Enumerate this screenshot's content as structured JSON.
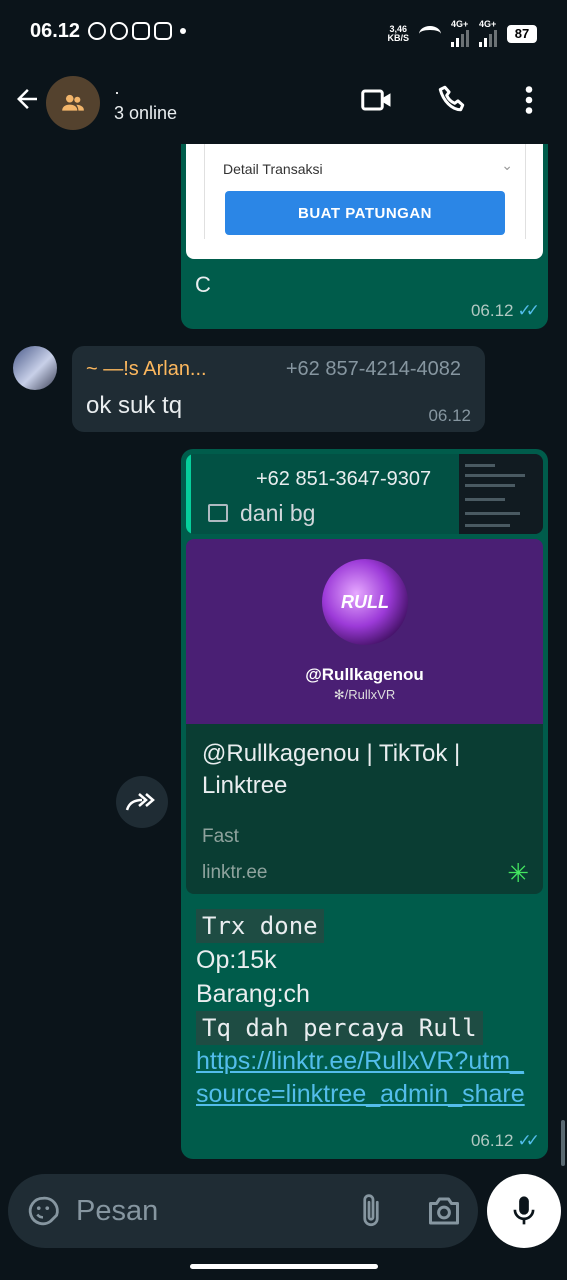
{
  "status": {
    "time": "06.12",
    "speed_value": "3,46",
    "speed_unit": "KB/S",
    "net1": "4G+",
    "net2": "4G+",
    "battery": "87"
  },
  "header": {
    "title": "·",
    "subtitle": "3 online"
  },
  "messages": {
    "m1": {
      "card_label": "Detail Transaksi",
      "card_button": "BUAT PATUNGAN",
      "text": "C",
      "time": "06.12"
    },
    "m2": {
      "sender": "~ —!s Arlan...",
      "phone": "+62 857-4214-4082",
      "text": "ok suk tq",
      "time": "06.12"
    },
    "m3": {
      "quote_phone": "+62 851-3647-9307",
      "quote_text": "dani bg",
      "logo_text": "RULL",
      "logo_handle": "@Rullkagenou",
      "logo_sub": "✻/RullxVR",
      "preview_title": "@Rullkagenou | TikTok | Linktree",
      "preview_desc": "Fast",
      "preview_domain": "linktr.ee",
      "line1": "Trx done",
      "line2": "Op:15k",
      "line3": "Barang:ch",
      "line4": "Tq dah percaya Rull",
      "link": "https://linktr.ee/RullxVR?utm_source=linktree_admin_share",
      "time": "06.12"
    }
  },
  "composer": {
    "placeholder": "Pesan"
  },
  "colors": {
    "outgoing": "#005c4b",
    "incoming": "#1f2c34",
    "read_tick": "#53bdeb",
    "sender_name": "#fdb85e"
  }
}
